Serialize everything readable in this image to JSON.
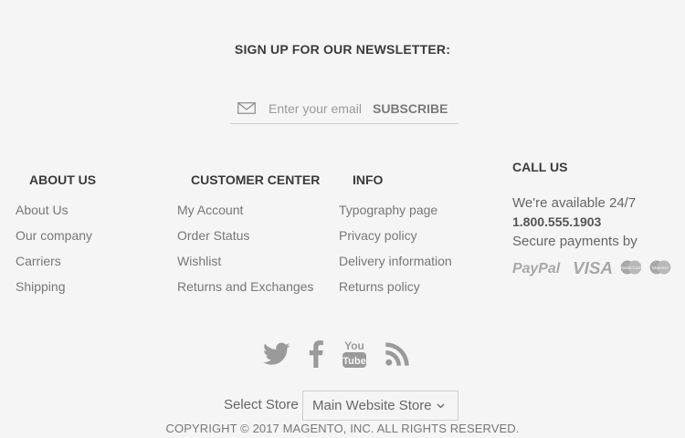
{
  "newsletter": {
    "title": "SIGN UP FOR OUR NEWSLETTER:",
    "placeholder": "Enter your email",
    "button": "SUBSCRIBE"
  },
  "about": {
    "title": "ABOUT US",
    "links": [
      "About Us",
      "Our company",
      "Carriers",
      "Shipping"
    ]
  },
  "customer": {
    "title": "CUSTOMER CENTER",
    "links": [
      "My Account",
      "Order Status",
      "Wishlist",
      "Returns and Exchanges"
    ]
  },
  "info": {
    "title": "INFO",
    "links": [
      "Typography page",
      "Privacy policy",
      "Delivery information",
      "Returns policy"
    ]
  },
  "call": {
    "title": "CALL US",
    "availability": "We're available 24/7",
    "phone": "1.800.555.1903",
    "payments": "Secure payments by",
    "payment_logos": [
      "PayPal",
      "VISA",
      "MasterCard",
      "Maestro"
    ]
  },
  "social": [
    "twitter-icon",
    "facebook-icon",
    "youtube-icon",
    "rss-icon"
  ],
  "store": {
    "label": "Select Store",
    "selected": "Main Website Store"
  },
  "copyright": "COPYRIGHT © 2017 MAGENTO, INC. ALL RIGHTS RESERVED.",
  "colors": {
    "background": "#f5f5f5",
    "heading": "#3b3b3b",
    "text": "#777777",
    "icon": "#9a9a9a"
  }
}
